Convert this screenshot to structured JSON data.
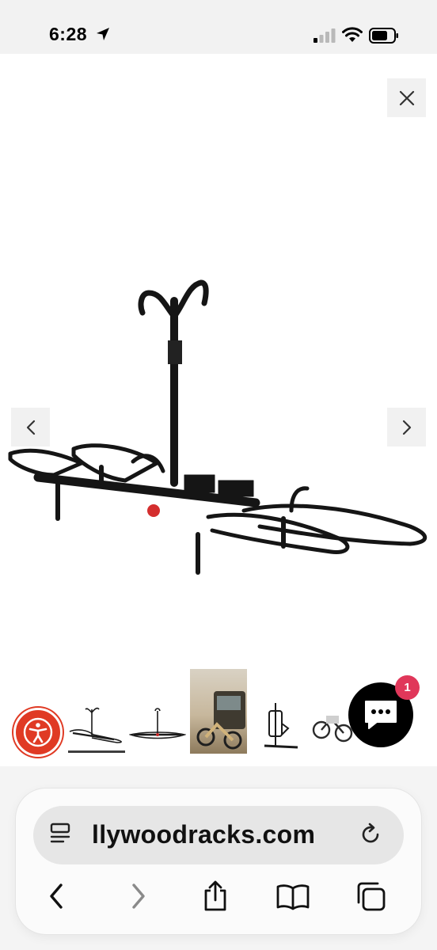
{
  "status_bar": {
    "time": "6:28"
  },
  "browser": {
    "url": "llywoodracks.com"
  },
  "chat": {
    "badge_count": "1"
  },
  "colors": {
    "accessibility": "#e03a24",
    "chat_badge": "#e0375a",
    "chat_button": "#000000"
  },
  "thumbnails": [
    {
      "name": "rack-front-view",
      "selected": true
    },
    {
      "name": "rack-side-view",
      "selected": false
    },
    {
      "name": "rack-on-vehicle-photo",
      "selected": false
    },
    {
      "name": "rack-folded-view",
      "selected": false
    },
    {
      "name": "rack-with-bikes-photo",
      "selected": false
    }
  ]
}
